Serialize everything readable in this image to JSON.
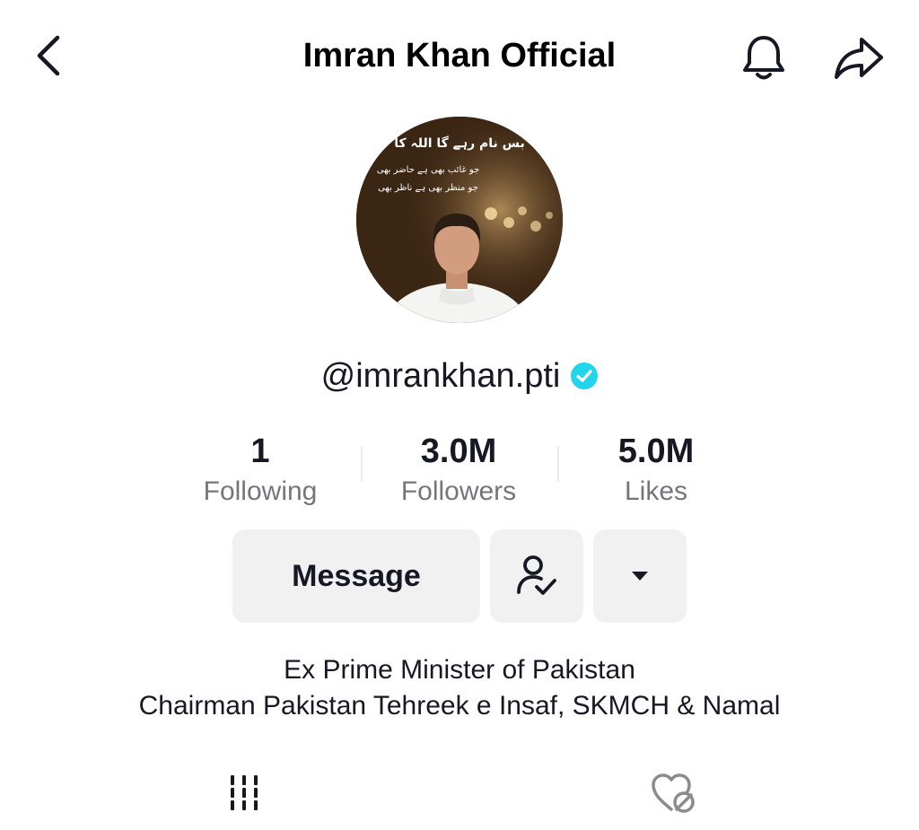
{
  "header": {
    "title": "Imran Khan Official",
    "back_icon": "chevron-left-icon",
    "bell_icon": "bell-icon",
    "share_icon": "share-arrow-icon"
  },
  "profile": {
    "avatar_caption_line1": "بس نام رہے گا اللہ کا",
    "avatar_caption_line2": "جو غائب بھی ہے حاضر بھی",
    "avatar_caption_line3": "جو منظر بھی ہے ناظر بھی",
    "username": "@imrankhan.pti",
    "verified": true,
    "verified_color": "#20d5ec"
  },
  "stats": [
    {
      "value": "1",
      "label": "Following"
    },
    {
      "value": "3.0M",
      "label": "Followers"
    },
    {
      "value": "5.0M",
      "label": "Likes"
    }
  ],
  "actions": {
    "message_label": "Message",
    "following_icon": "user-check-icon",
    "more_icon": "caret-down-icon"
  },
  "bio": {
    "line1": "Ex Prime Minister of Pakistan",
    "line2": "Chairman Pakistan Tehreek e Insaf, SKMCH & Namal"
  },
  "tabs": [
    {
      "icon": "grid-videos-icon"
    },
    {
      "icon": "liked-hidden-icon"
    }
  ]
}
